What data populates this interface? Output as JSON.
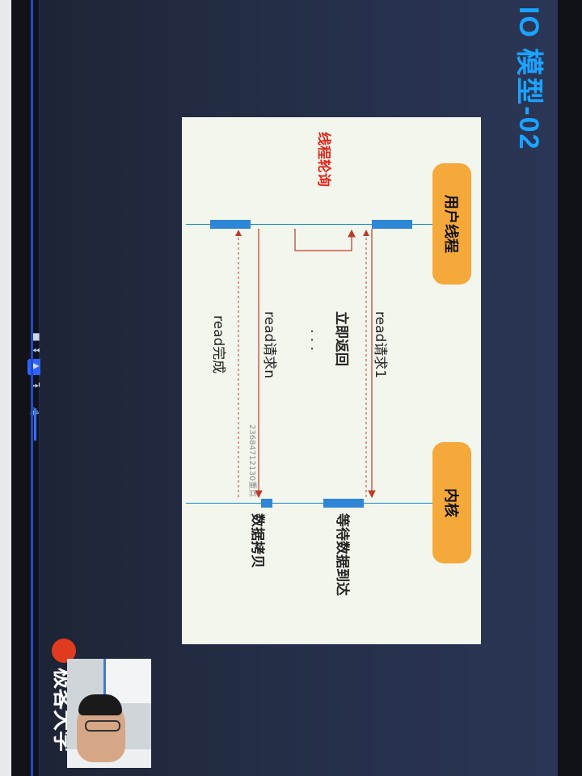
{
  "player": {
    "stop_icon": "■",
    "prev_icon": "⏮",
    "play_icon": "▶",
    "next_icon": "⏭",
    "volume_icon": "🔈",
    "accent": "#2f63ff"
  },
  "slide": {
    "title": "IO 模型-02",
    "user_thread_label": "用户线程",
    "kernel_label": "内核",
    "polling_label": "线程轮询",
    "read_req1": "read请求1",
    "immediate_return": "立即返回",
    "ellipsis": "· · ·",
    "read_reqn": "read请求n",
    "read_done": "read完成",
    "watermark": "23684712130重点",
    "wait_data": "等待数据到达",
    "data_copy": "数据拷贝",
    "logo_text": "极客大学",
    "accent_title": "#1aa3ff",
    "accent_red": "#e2231a",
    "label_bg": "#f5a93a"
  }
}
